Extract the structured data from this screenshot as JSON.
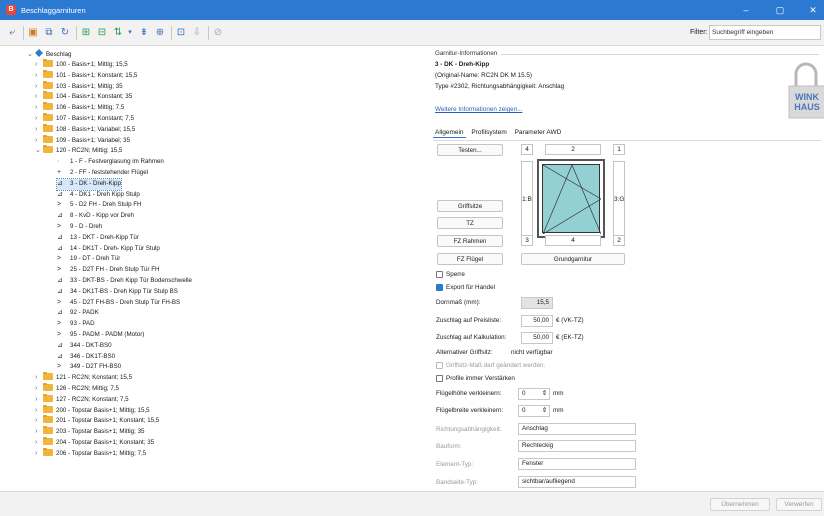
{
  "window": {
    "title": "Beschlaggarnituren",
    "min": "–",
    "max": "▢",
    "close": "✕"
  },
  "toolbar": {
    "filter_label": "Filter:",
    "filter_placeholder": "Suchbegriff eingeben",
    "filter_more": "↓"
  },
  "tree": {
    "root": "Beschlag",
    "items": [
      {
        "label": "100 - Basis+1; Mittig; 15,5",
        "type": "folder"
      },
      {
        "label": "101 - Basis+1; Konstant; 15,5",
        "type": "folder"
      },
      {
        "label": "103 - Basis+1; Mittig; 35",
        "type": "folder"
      },
      {
        "label": "104 - Basis+1; Konstant; 35",
        "type": "folder"
      },
      {
        "label": "106 - Basis+1; Mittig; 7,5",
        "type": "folder"
      },
      {
        "label": "107 - Basis+1; Konstant; 7,5",
        "type": "folder"
      },
      {
        "label": "108 - Basis+1; Variabel; 15,5",
        "type": "folder"
      },
      {
        "label": "109 - Basis+1; Variabel; 35",
        "type": "folder"
      },
      {
        "label": "120 - RC2N; Mittig; 15,5",
        "type": "folder-open"
      },
      {
        "label": "1 - F - Festverglasung im Rahmen",
        "type": "child",
        "icon": "·"
      },
      {
        "label": "2 - FF - feststehender Flügel",
        "type": "child",
        "icon": "+"
      },
      {
        "label": "3 - DK - Dreh-Kipp",
        "type": "child",
        "icon": "⊿",
        "selected": true
      },
      {
        "label": "4 - DK1 - Dreh Kipp Stulp",
        "type": "child",
        "icon": "⊿"
      },
      {
        "label": "5 - D2 FH - Dreh Stulp FH",
        "type": "child",
        "icon": ">"
      },
      {
        "label": "8 - KvD - Kipp vor Dreh",
        "type": "child",
        "icon": "⊿"
      },
      {
        "label": "9 - D - Dreh",
        "type": "child",
        "icon": ">"
      },
      {
        "label": "13 - DKT - Dreh-Kipp Tür",
        "type": "child",
        "icon": "⊿"
      },
      {
        "label": "14 - DK1T - Dreh- Kipp Tür Stulp",
        "type": "child",
        "icon": "⊿"
      },
      {
        "label": "19 - DT - Dreh Tür",
        "type": "child",
        "icon": ">"
      },
      {
        "label": "25 - D2T FH - Dreh Stulp Tür FH",
        "type": "child",
        "icon": ">"
      },
      {
        "label": "33 - DKT-BS - Dreh Kipp Tür Bodenschwelle",
        "type": "child",
        "icon": "⊿"
      },
      {
        "label": "34 - DK1T-BS - Dreh Kipp Tür Stulp BS",
        "type": "child",
        "icon": "⊿"
      },
      {
        "label": "45 - D2T FH-BS - Dreh Stulp Tür FH-BS",
        "type": "child",
        "icon": ">"
      },
      {
        "label": "92 - PADK",
        "type": "child",
        "icon": "⊿"
      },
      {
        "label": "93 - PAD",
        "type": "child",
        "icon": ">"
      },
      {
        "label": "95 - PADM - PADM (Motor)",
        "type": "child",
        "icon": ">"
      },
      {
        "label": "344 - DKT-BS0",
        "type": "child",
        "icon": "⊿"
      },
      {
        "label": "346 - DK1T-BS0",
        "type": "child",
        "icon": "⊿"
      },
      {
        "label": "349 - D2T FH-BS0",
        "type": "child",
        "icon": ">"
      },
      {
        "label": "121 - RC2N; Konstant; 15,5",
        "type": "folder"
      },
      {
        "label": "126 - RC2N; Mittig; 7,5",
        "type": "folder"
      },
      {
        "label": "127 - RC2N; Konstant; 7,5",
        "type": "folder"
      },
      {
        "label": "200 - Topstar Basis+1; Mittig; 15,5",
        "type": "folder"
      },
      {
        "label": "201 - Topstar Basis+1; Konstant; 15,5",
        "type": "folder"
      },
      {
        "label": "203 - Topstar Basis+1; Mittig; 35",
        "type": "folder"
      },
      {
        "label": "204 - Topstar Basis+1; Konstant; 35",
        "type": "folder"
      },
      {
        "label": "206 - Topstar Basis+1; Mittig; 7,5",
        "type": "folder"
      }
    ]
  },
  "info": {
    "legend": "Garnitur-Informationen",
    "name": "3 - DK - Dreh-Kipp",
    "original": "(Original-Name: RC2N DK M 15.5)",
    "type": "Type #2302, Richtungsabhängigkeit: Anschlag",
    "more_link": "Weitere Informationen zeigen...",
    "brand_line1": "WINK",
    "brand_line2": "HAUS"
  },
  "tabs": [
    "Allgemein",
    "Profilsystem",
    "Parameter AWD"
  ],
  "general": {
    "btn_testen": "Testen...",
    "btn_griffsitze": "Griffsitze",
    "btn_tz": "TZ",
    "btn_fz_rahmen": "FZ Rahmen",
    "btn_fz_fluegel": "FZ Flügel",
    "btn_grund": "Grundgarnitur",
    "box_top_left": "4",
    "box_top_mid": "2",
    "box_top_right": "1",
    "box_bot_left": "3",
    "box_bot_mid": "4",
    "box_bot_right": "2",
    "side_left": "1:B",
    "side_right": "3:G",
    "sperre": "Sperre",
    "export": "Export für Handel",
    "dornmass_label": "Dornmaß (mm):",
    "dornmass_value": "15,5",
    "zpl_label": "Zuschlag auf Preisliste:",
    "zpl_value": "50,00",
    "zpl_unit": "€ (VK-TZ)",
    "zkk_label": "Zuschlag auf Kalkulation:",
    "zkk_value": "50,00",
    "zkk_unit": "€ (EK-TZ)",
    "alt_label": "Alternativer Griffsitz:",
    "alt_value": "nicht verfügbar",
    "griff_change": "Griffsitz-Maß darf geändert werden.",
    "profile_staerk": "Profile immer Verstärken",
    "fh_label": "Flügelhöhe verkleinern:",
    "fh_value": "0",
    "fb_label": "Flügelbreite verkleinern:",
    "fb_value": "0",
    "mm": "mm",
    "richtung_label": "Richtungsabhängigkeit:",
    "richtung_value": "Anschlag",
    "bauform_label": "Bauform:",
    "bauform_value": "Rechteckig",
    "element_label": "Element-Typ:",
    "element_value": "Fenster",
    "band_label": "Bandseite-Typ:",
    "band_value": "sichtbar/aufliegend"
  },
  "footer": {
    "apply": "Übernehmen",
    "discard": "Verwerfen"
  },
  "colors": {
    "accent": "#2b79d1",
    "selection": "#d7e6f8",
    "glass": "#93d0d3",
    "folder": "#f2b53b"
  }
}
